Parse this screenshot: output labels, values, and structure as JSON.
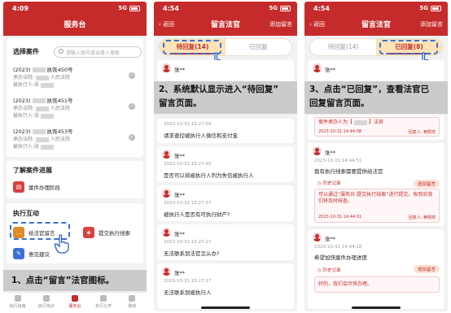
{
  "screen1": {
    "status": {
      "time": "4:09",
      "signal": "5G"
    },
    "title": "服务台",
    "select_case": {
      "label": "选择案件",
      "search_placeholder": "请输入案号或当事人搜索"
    },
    "cases": [
      {
        "no_prefix": "(2023)",
        "no_suffix": "执恢450号",
        "court_prefix": "承办法院:",
        "court_suffix": "人民法院",
        "party": "被执行人:张"
      },
      {
        "no_prefix": "(2023)",
        "no_suffix": "执恢451号",
        "court_prefix": "承办法院:",
        "court_suffix": "人民法院",
        "party": "被执行人:张"
      },
      {
        "no_prefix": "(2023)",
        "no_suffix": "执恢453号",
        "court_prefix": "承办法院:",
        "court_suffix": "人民法院",
        "party": "被执行人:张"
      }
    ],
    "progress": {
      "title": "了解案件进展",
      "item": "案件办理阶段"
    },
    "interaction": {
      "title": "执行互动",
      "items": [
        "给法官留言",
        "提交执行线索",
        "意见建议"
      ]
    },
    "tabs": [
      "执行指南",
      "执行地点",
      "服务台",
      "执行公开",
      "我的"
    ],
    "active_tab": 2,
    "callout": "1、点击“留言”法官图标。"
  },
  "screen2": {
    "status": {
      "time": "4:54",
      "signal": "5G"
    },
    "back": "返回",
    "title": "留言法官",
    "add_message": "添加留言",
    "tabs": {
      "pending": "待回复",
      "pending_count": "(14)",
      "replied": "已回复"
    },
    "callout_line1": "2、系统默认显示进入“待回复”",
    "callout_line2": "留言页面。",
    "messages": [
      {
        "name": "张**",
        "time": "",
        "text": ""
      },
      {
        "name": "",
        "time": "2023-10-31 15:27:54",
        "text": "请求查控被执行人微信和支付宝"
      },
      {
        "name": "张**",
        "time": "2023-10-31 15:27:45",
        "text": "是否可以将被执行人列为失信被执行人"
      },
      {
        "name": "张**",
        "time": "2023-10-31 15:27:37",
        "text": "被执行人是否有可执行财产?"
      },
      {
        "name": "张**",
        "time": "2023-10-31 15:27:27",
        "text": "无法联系到法官怎么办?"
      },
      {
        "name": "张**",
        "time": "2023-10-31 15:27:17",
        "text": "无法联系到被执行人"
      }
    ]
  },
  "screen3": {
    "status": {
      "time": "4:54",
      "signal": "5G"
    },
    "back": "返回",
    "title": "留言法官",
    "add_message": "添加留言",
    "tabs": {
      "pending": "待回复",
      "pending_count": "(14)",
      "replied": "已回复",
      "replied_count": "(8)"
    },
    "callout_line1": "3、点击“已回复”，查看法官已",
    "callout_line2": "回复留言页面。",
    "messages": [
      {
        "name": "张**"
      },
      {
        "reply_text": "案件承办人为【",
        "reply_text2": "】法官",
        "reply_time": "2023-10-31 14:44:08",
        "reply_by": "回复人: 黄刚祥"
      },
      {
        "name": "张**",
        "time": "2023-10-31 14:44:51",
        "text": "我有执行线索需要提供给法官",
        "history": "历史记录",
        "add_reply": "追加留言",
        "reply_text": "可以通过“服务台-提交执行线索”进行提交。收到后我们将及时核查。",
        "reply_time": "2023-10-31 14:44:01",
        "reply_by": "回复人: 黄刚祥"
      },
      {
        "name": "张**",
        "time": "2023-10-31 14:44:18",
        "text": "希望加快案件办理进度",
        "history": "历史记录",
        "add_reply": "追加留言",
        "reply_text": "好的，我们会尽快办理。"
      }
    ]
  }
}
